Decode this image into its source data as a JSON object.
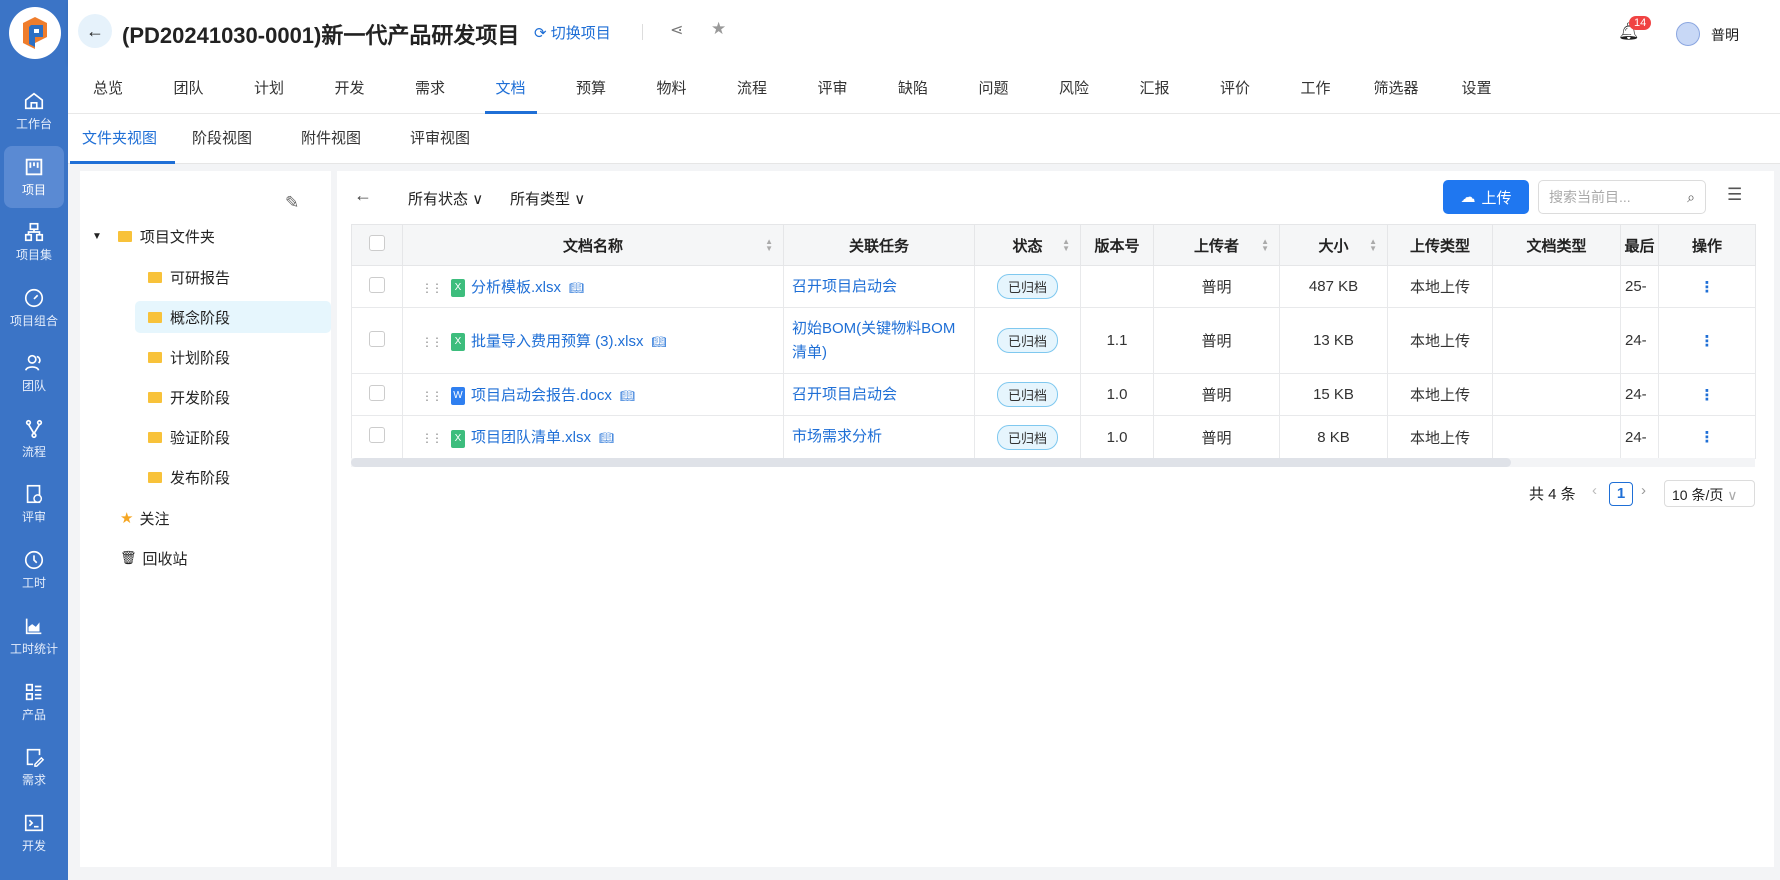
{
  "header": {
    "title": "(PD20241030-0001)新一代产品研发项目",
    "switch_label": "切换项目",
    "notification_count": "14",
    "user_name": "普明"
  },
  "sidebar": {
    "items": [
      {
        "label": "工作台",
        "icon": "home-icon"
      },
      {
        "label": "项目",
        "icon": "kanban-icon"
      },
      {
        "label": "项目集",
        "icon": "hierarchy-icon"
      },
      {
        "label": "项目组合",
        "icon": "gauge-icon"
      },
      {
        "label": "团队",
        "icon": "team-icon"
      },
      {
        "label": "流程",
        "icon": "branch-icon"
      },
      {
        "label": "评审",
        "icon": "review-icon"
      },
      {
        "label": "工时",
        "icon": "clock-icon"
      },
      {
        "label": "工时统计",
        "icon": "area-chart-icon"
      },
      {
        "label": "产品",
        "icon": "product-icon"
      },
      {
        "label": "需求",
        "icon": "edit-doc-icon"
      },
      {
        "label": "开发",
        "icon": "terminal-icon"
      }
    ]
  },
  "tabs": [
    "总览",
    "团队",
    "计划",
    "开发",
    "需求",
    "文档",
    "预算",
    "物料",
    "流程",
    "评审",
    "缺陷",
    "问题",
    "风险",
    "汇报",
    "评价",
    "工作",
    "筛选器",
    "设置"
  ],
  "subtabs": [
    "文件夹视图",
    "阶段视图",
    "附件视图",
    "评审视图"
  ],
  "tree": {
    "root": "项目文件夹",
    "children": [
      "可研报告",
      "概念阶段",
      "计划阶段",
      "开发阶段",
      "验证阶段",
      "发布阶段"
    ],
    "favorites": "关注",
    "recycle": "回收站"
  },
  "toolbar": {
    "status_filter": "所有状态",
    "type_filter": "所有类型",
    "upload_label": "上传",
    "search_placeholder": "搜索当前目..."
  },
  "table": {
    "columns": [
      "文档名称",
      "关联任务",
      "状态",
      "版本号",
      "上传者",
      "大小",
      "上传类型",
      "文档类型",
      "最后",
      "操作"
    ],
    "rows": [
      {
        "name": "分析模板.xlsx",
        "type": "x",
        "task": "召开项目启动会",
        "status": "已归档",
        "version": "",
        "uploader": "普明",
        "size": "487 KB",
        "upload_type": "本地上传",
        "doc_type": "",
        "last": "25-"
      },
      {
        "name": "批量导入费用预算 (3).xlsx",
        "type": "x",
        "task": "初始BOM(关键物料BOM清单)",
        "status": "已归档",
        "version": "1.1",
        "uploader": "普明",
        "size": "13 KB",
        "upload_type": "本地上传",
        "doc_type": "",
        "last": "24-"
      },
      {
        "name": "项目启动会报告.docx",
        "type": "w",
        "task": "召开项目启动会",
        "status": "已归档",
        "version": "1.0",
        "uploader": "普明",
        "size": "15 KB",
        "upload_type": "本地上传",
        "doc_type": "",
        "last": "24-"
      },
      {
        "name": "项目团队清单.xlsx",
        "type": "x",
        "task": "市场需求分析",
        "status": "已归档",
        "version": "1.0",
        "uploader": "普明",
        "size": "8 KB",
        "upload_type": "本地上传",
        "doc_type": "",
        "last": "24-"
      }
    ]
  },
  "pagination": {
    "total": "共 4 条",
    "page": "1",
    "page_size": "10 条/页"
  },
  "colors": {
    "sidebar": "#3b74c6",
    "accent": "#1f6fd6",
    "excel": "#3dbd7d",
    "word": "#2f7ff0"
  }
}
